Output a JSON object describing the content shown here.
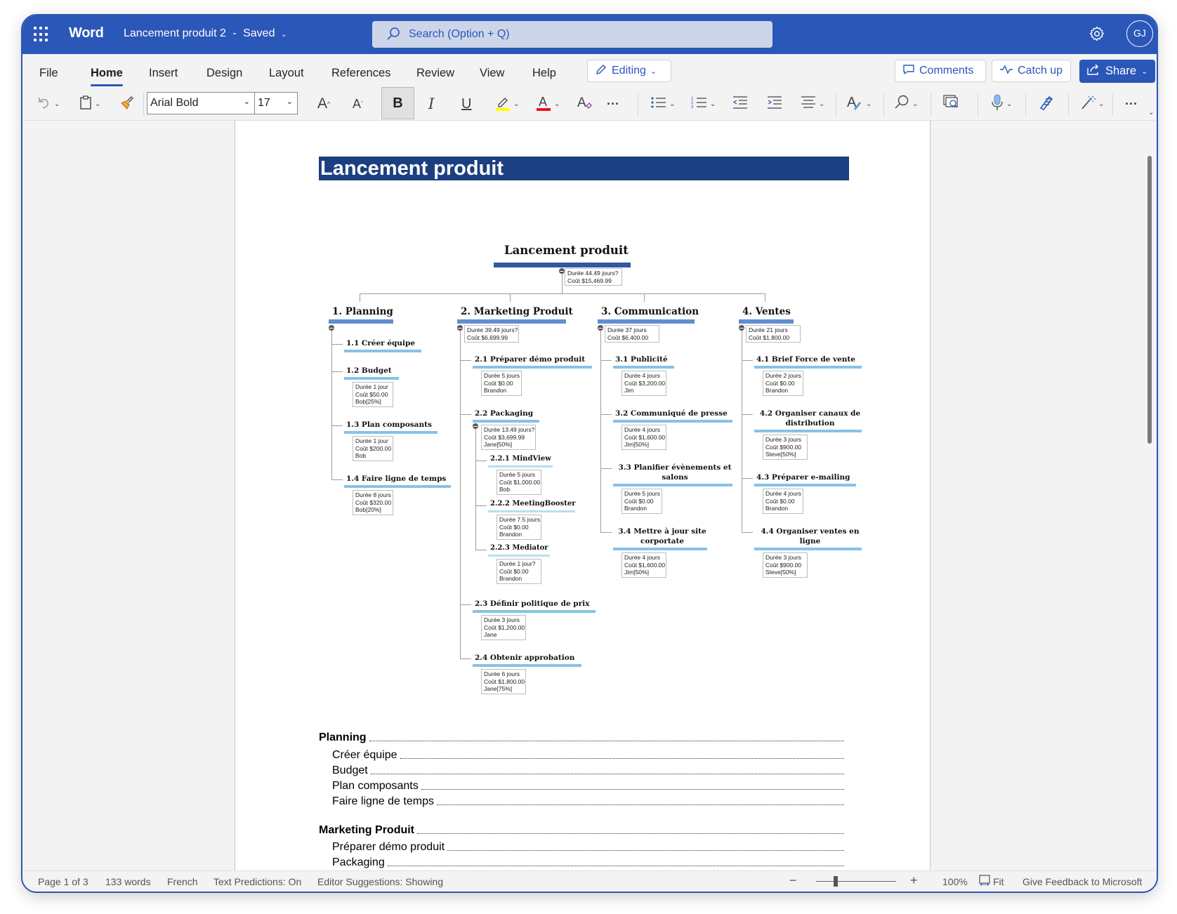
{
  "titlebar": {
    "app_name": "Word",
    "doc_name": "Lancement produit 2",
    "separator": "-",
    "save_status": "Saved",
    "search_placeholder": "Search (Option + Q)",
    "avatar_initials": "GJ"
  },
  "ribbon": {
    "tabs": [
      {
        "label": "File",
        "active": false
      },
      {
        "label": "Home",
        "active": true
      },
      {
        "label": "Insert",
        "active": false
      },
      {
        "label": "Design",
        "active": false
      },
      {
        "label": "Layout",
        "active": false
      },
      {
        "label": "References",
        "active": false
      },
      {
        "label": "Review",
        "active": false
      },
      {
        "label": "View",
        "active": false
      },
      {
        "label": "Help",
        "active": false
      }
    ],
    "editing_label": "Editing",
    "comments_label": "Comments",
    "catchup_label": "Catch up",
    "share_label": "Share"
  },
  "toolbar": {
    "font_name": "Arial Bold",
    "font_size": "17",
    "bold_label": "B",
    "italic_label": "I",
    "underline_label": "U",
    "grow_font_label": "A",
    "shrink_font_label": "A",
    "highlight_color": "#ffff00",
    "font_color": "#e81123",
    "more_label": "···"
  },
  "document": {
    "heading": "Lancement produit",
    "wbs": {
      "root": {
        "title": "Lancement produit",
        "duree": "44.49 jours?",
        "cout": "$15,469.99"
      },
      "labels": {
        "duree": "Durée",
        "cout": "Coût"
      },
      "columns": [
        {
          "title": "1.  Planning",
          "duree": null,
          "cout": null,
          "tasks": [
            {
              "label": "1.1  Créer équipe",
              "duree": null,
              "cout": null,
              "resource": null
            },
            {
              "label": "1.2  Budget",
              "duree": "1 jour",
              "cout": "$50.00",
              "resource": "Bob[25%]"
            },
            {
              "label": "1.3  Plan composants",
              "duree": "1 jour",
              "cout": "$200.00",
              "resource": "Bob"
            },
            {
              "label": "1.4  Faire ligne de temps",
              "duree": "8 jours",
              "cout": "$320.00",
              "resource": "Bob[20%]"
            }
          ]
        },
        {
          "title": "2.  Marketing Produit",
          "duree": "39.49 jours?",
          "cout": "$6,699.99",
          "tasks": [
            {
              "label": "2.1  Préparer démo produit",
              "duree": "5 jours",
              "cout": "$0.00",
              "resource": "Brandon"
            },
            {
              "label": "2.2  Packaging",
              "duree": "13.49 jours?",
              "cout": "$3,699.99",
              "resource": "Jane[50%]",
              "subtasks": [
                {
                  "label": "2.2.1  MindView",
                  "duree": "5 jours",
                  "cout": "$1,000.00",
                  "resource": "Bob"
                },
                {
                  "label": "2.2.2  MeetingBooster",
                  "duree": "7.5 jours",
                  "cout": "$0.00",
                  "resource": "Brandon"
                },
                {
                  "label": "2.2.3  Mediator",
                  "duree": "1 jour?",
                  "cout": "$0.00",
                  "resource": "Brandon"
                }
              ]
            },
            {
              "label": "2.3  Définir politique de prix",
              "duree": "3 jours",
              "cout": "$1,200.00",
              "resource": "Jane"
            },
            {
              "label": "2.4  Obtenir approbation",
              "duree": "6 jours",
              "cout": "$1,800.00",
              "resource": "Jane[75%]"
            }
          ]
        },
        {
          "title": "3.  Communication",
          "duree": "37 jours",
          "cout": "$6,400.00",
          "tasks": [
            {
              "label": "3.1  Publicité",
              "duree": "4 jours",
              "cout": "$3,200.00",
              "resource": "Jim"
            },
            {
              "label": "3.2  Communiqué de presse",
              "duree": "4 jours",
              "cout": "$1,600.00",
              "resource": "Jim[50%]"
            },
            {
              "label": "3.3  Planifier évènements et salons",
              "duree": "5 jours",
              "cout": "$0.00",
              "resource": "Brandon"
            },
            {
              "label": "3.4  Mettre à jour site corportate",
              "duree": "4 jours",
              "cout": "$1,600.00",
              "resource": "Jim[50%]"
            }
          ]
        },
        {
          "title": "4.  Ventes",
          "duree": "21 jours",
          "cout": "$1,800.00",
          "tasks": [
            {
              "label": "4.1  Brief Force de vente",
              "duree": "2 jours",
              "cout": "$0.00",
              "resource": "Brandon"
            },
            {
              "label": "4.2  Organiser canaux de distribution",
              "duree": "3 jours",
              "cout": "$900.00",
              "resource": "Steve[50%]"
            },
            {
              "label": "4.3  Préparer e-mailing",
              "duree": "4 jours",
              "cout": "$0.00",
              "resource": "Brandon"
            },
            {
              "label": "4.4  Organiser ventes en ligne",
              "duree": "3 jours",
              "cout": "$900.00",
              "resource": "Steve[50%]"
            }
          ]
        }
      ]
    },
    "toc": [
      {
        "label": "Planning",
        "level": 1
      },
      {
        "label": "Créer équipe",
        "level": 2
      },
      {
        "label": "Budget",
        "level": 2
      },
      {
        "label": "Plan composants",
        "level": 2
      },
      {
        "label": "Faire ligne de temps",
        "level": 2
      },
      {
        "label": "Marketing Produit",
        "level": 1
      },
      {
        "label": "Préparer démo produit",
        "level": 2
      },
      {
        "label": "Packaging",
        "level": 2
      }
    ]
  },
  "statusbar": {
    "page": "Page 1 of 3",
    "words": "133 words",
    "language": "French",
    "text_predictions": "Text Predictions: On",
    "editor_suggestions": "Editor Suggestions: Showing",
    "zoom_minus": "−",
    "zoom_plus": "+",
    "zoom_level": "100%",
    "zoom_slider_percent": 100,
    "fit_label": "Fit",
    "feedback": "Give Feedback to Microsoft"
  },
  "colors": {
    "brand": "#2b57b8",
    "heading_bar": "#1c3f82",
    "root_bar": "#2d5aa0",
    "level1_bar": "#5f8fd0",
    "level2_bar": "#86c3e6",
    "level3_bar": "#b7def2"
  }
}
